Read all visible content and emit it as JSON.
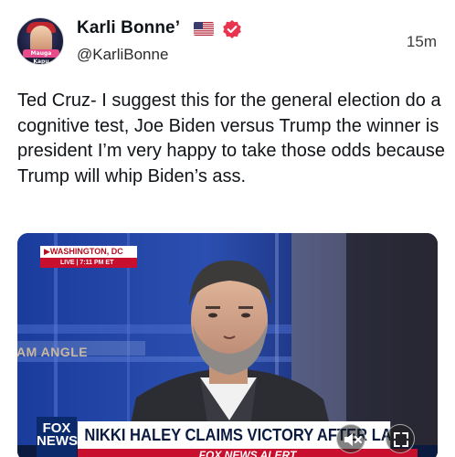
{
  "post": {
    "display_name": "Karli Bonne’",
    "handle": "@KarliBonne",
    "timestamp": "15m",
    "text": "Ted Cruz- I suggest this for the general election do a cognitive test, Joe Biden versus Trump the winner is president I’m very happy to take those odds because Trump will whip Biden’s ass.",
    "flag_icon": "us-flag-icon",
    "verified_icon": "verified-badge-icon",
    "verified_color": "#e8344e"
  },
  "avatar": {
    "text": "Mauga Kapu"
  },
  "video": {
    "location": "WASHINGTON, DC",
    "live_label": "LIVE",
    "live_time": "7:11 PM ET",
    "show_logo": "AM ANGLE",
    "network_logo": [
      "FOX",
      "NEWS"
    ],
    "headline": "NIKKI HALEY CLAIMS VICTORY AFTER LATEST LOSS",
    "alert": "FOX NEWS ALERT",
    "mute_icon": "muted-speaker-icon",
    "expand_icon": "expand-icon"
  }
}
